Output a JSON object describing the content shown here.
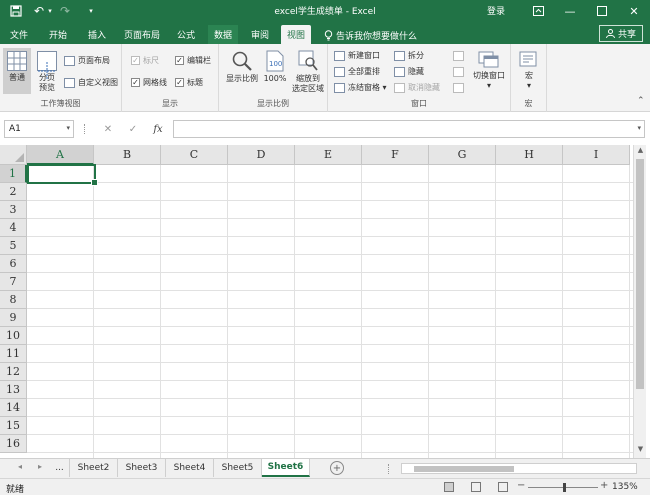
{
  "window": {
    "title": "excel学生成绩单 - Excel",
    "login_label": "登录",
    "minimize_glyph": "—",
    "restore_glyph": "❐",
    "maximize_glyph": "☐",
    "close_glyph": "✕",
    "save_glyph": "💾",
    "undo_glyph": "↶",
    "redo_glyph": "↷",
    "customize_glyph": "▾"
  },
  "tabs": [
    {
      "label": "文件"
    },
    {
      "label": "开始"
    },
    {
      "label": "插入"
    },
    {
      "label": "页面布局"
    },
    {
      "label": "公式"
    },
    {
      "label": "数据"
    },
    {
      "label": "审阅"
    },
    {
      "label": "视图"
    }
  ],
  "tell_me": "告诉我你想要做什么",
  "share_label": "共享",
  "ribbon": {
    "workbook_views": {
      "label": "工作簿视图",
      "normal": "普通",
      "page_break": "分页\n预览",
      "page_layout": "页面布局",
      "custom_views": "自定义视图"
    },
    "show": {
      "label": "显示",
      "ruler": "标尺",
      "gridlines": "网格线",
      "formula_bar": "编辑栏",
      "headings": "标题",
      "check": "✓"
    },
    "zoom": {
      "label": "显示比例",
      "zoom": "显示比例",
      "hundred": "100%",
      "zoom_selection": "缩放到\n选定区域"
    },
    "window": {
      "label": "窗口",
      "new_window": "新建窗口",
      "arrange_all": "全部重排",
      "freeze_panes": "冻结窗格 ▾",
      "split": "拆分",
      "hide": "隐藏",
      "unhide": "取消隐藏",
      "switch_windows": "切换窗口",
      "switch_arrow": "▾"
    },
    "macros": {
      "label": "宏",
      "macros": "宏",
      "arrow": "▾"
    },
    "collapse_glyph": "⌃"
  },
  "formula_bar": {
    "name_box": "A1",
    "cancel_glyph": "✕",
    "enter_glyph": "✓",
    "fx_glyph": "fx",
    "formula_value": "",
    "dropdown_glyph": "▾"
  },
  "columns": [
    "A",
    "B",
    "C",
    "D",
    "E",
    "F",
    "G",
    "H",
    "I"
  ],
  "rows": [
    "1",
    "2",
    "3",
    "4",
    "5",
    "6",
    "7",
    "8",
    "9",
    "10",
    "11",
    "12",
    "13",
    "14",
    "15",
    "16"
  ],
  "sheets": {
    "nav_prev": "◂",
    "nav_next": "▸",
    "more": "...",
    "tabs": [
      "Sheet2",
      "Sheet3",
      "Sheet4",
      "Sheet5",
      "Sheet6"
    ],
    "active": "Sheet6",
    "add": "+"
  },
  "status": {
    "ready": "就绪",
    "zoom_minus": "−",
    "zoom_plus": "+",
    "zoom": "135%"
  },
  "colors": {
    "accent": "#217346"
  }
}
